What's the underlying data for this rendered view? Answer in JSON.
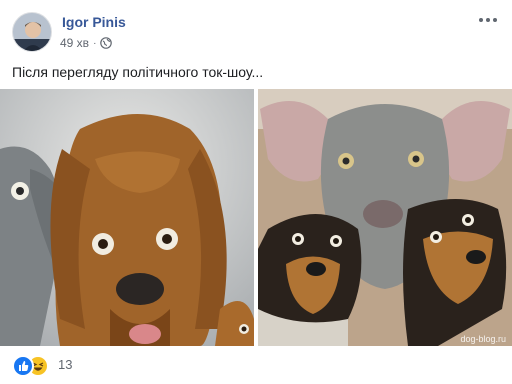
{
  "post": {
    "author_name": "Igor Pinis",
    "timestamp": "49 хв",
    "privacy_icon": "globe-icon",
    "text": "Після перегляду політичного ток-шоу...",
    "photo_left": {
      "subject": "bloodhound-dog-photo"
    },
    "photo_right": {
      "subject": "weimaraner-and-dachshunds-photo",
      "watermark": "dog-blog.ru"
    },
    "reactions": {
      "icons": [
        "like-icon",
        "haha-icon"
      ],
      "count": "13"
    }
  },
  "colors": {
    "author_link": "#385898",
    "meta_text": "#616770",
    "like_blue": "#1877f2",
    "haha_yellow": "#f7c325"
  }
}
